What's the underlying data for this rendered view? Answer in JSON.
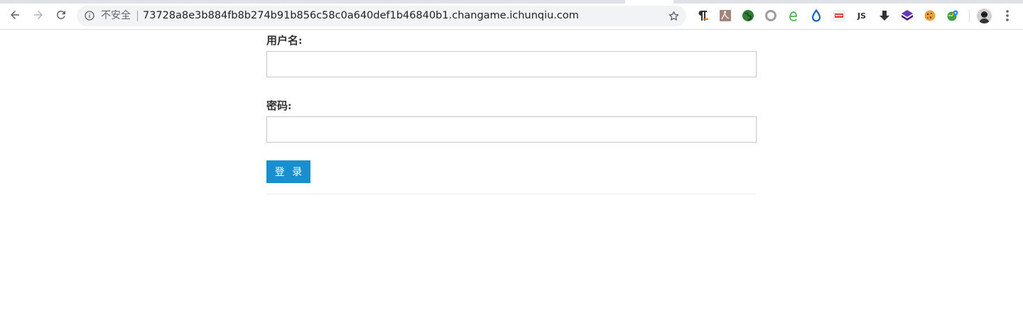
{
  "browser": {
    "security_label": "不安全",
    "url": "73728a8e3b884fb8b274b91b856c58c0a640def1b46840b1.changame.ichunqiu.com",
    "extensions": [
      {
        "icon": "paragraph-icon"
      },
      {
        "icon": "pdf-icon"
      },
      {
        "icon": "green-globe-icon"
      },
      {
        "icon": "grey-circle-icon"
      },
      {
        "icon": "e-leaf-icon"
      },
      {
        "icon": "water-drop-icon"
      },
      {
        "icon": "pdf-badge-icon"
      },
      {
        "icon": "js-icon",
        "label": "JS"
      },
      {
        "icon": "download-arrow-icon"
      },
      {
        "icon": "purple-cube-icon"
      },
      {
        "icon": "cookie-icon"
      },
      {
        "icon": "globe-pin-icon"
      }
    ],
    "colors": {
      "toolbar_bg": "#ffffff",
      "omnibox_bg": "#f1f3f4"
    }
  },
  "form": {
    "username_label": "用户名:",
    "username_value": "",
    "password_label": "密码:",
    "password_value": "",
    "submit_label": "登 录",
    "colors": {
      "submit_bg": "#1a8fcf",
      "input_border": "#c6c6c6"
    }
  }
}
